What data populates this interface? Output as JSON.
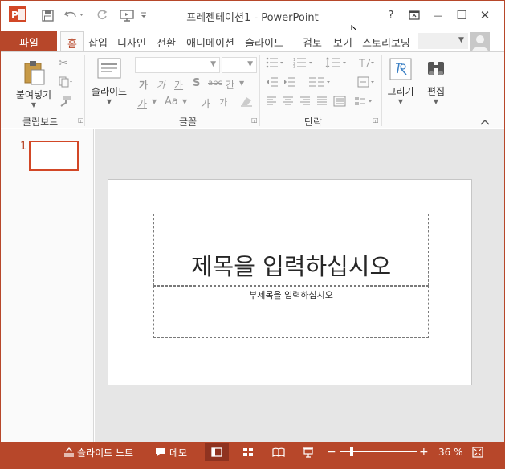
{
  "window": {
    "title": "프레젠테이션1 - PowerPoint",
    "app_icon_letter": "P",
    "controls": {
      "help": "?",
      "minimize": "—",
      "maximize": "☐",
      "close": "✕"
    }
  },
  "quick_access": {
    "icons": [
      "save-icon",
      "undo-icon",
      "redo-icon",
      "start-from-beginning-icon",
      "customize-icon"
    ]
  },
  "tabs": {
    "file": "파일",
    "items": [
      {
        "label": "홈",
        "active": true
      },
      {
        "label": "삽입"
      },
      {
        "label": "디자인"
      },
      {
        "label": "전환"
      },
      {
        "label": "애니메이션"
      },
      {
        "label": "슬라이드"
      },
      {
        "label": "검토"
      },
      {
        "label": "보기"
      },
      {
        "label": "스토리보딩"
      }
    ]
  },
  "ribbon": {
    "clipboard": {
      "paste_label": "붙여넣기",
      "group_label": "클립보드"
    },
    "slides": {
      "slide_label": "슬라이드"
    },
    "font": {
      "group_label": "글꼴",
      "row1": [
        "가",
        "가",
        "가",
        "S",
        "abc",
        "간"
      ],
      "row2": [
        "가",
        "Aa",
        "가",
        "가"
      ]
    },
    "paragraph": {
      "group_label": "단락"
    },
    "drawing": {
      "label": "그리기"
    },
    "editing": {
      "label": "편집"
    }
  },
  "thumbnails": {
    "slide_number": "1"
  },
  "slide": {
    "title_placeholder": "제목을 입력하십시오",
    "subtitle_placeholder": "부제목을 입력하십시오"
  },
  "status_bar": {
    "notes": "슬라이드 노트",
    "comments": "메모",
    "zoom_level": "36 %",
    "zoom_value": 0.36
  },
  "colors": {
    "accent": "#b7472a",
    "thumbnail_border": "#d24726"
  }
}
